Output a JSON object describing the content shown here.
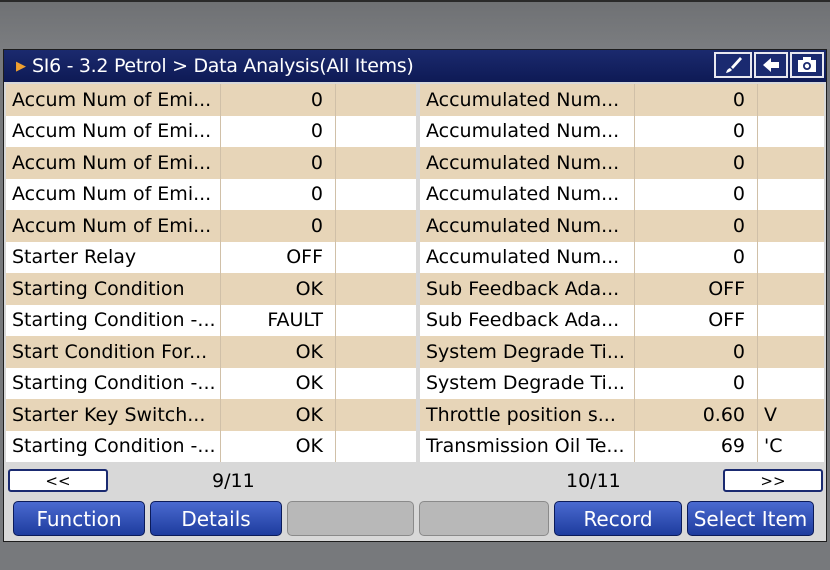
{
  "header": {
    "title": "SI6 - 3.2 Petrol > Data Analysis(All Items)"
  },
  "left_rows": [
    {
      "name": "Accum Num of Emi...",
      "value": "0",
      "unit": ""
    },
    {
      "name": "Accum Num of Emi...",
      "value": "0",
      "unit": ""
    },
    {
      "name": "Accum Num of Emi...",
      "value": "0",
      "unit": ""
    },
    {
      "name": "Accum Num of Emi...",
      "value": "0",
      "unit": ""
    },
    {
      "name": "Accum Num of Emi...",
      "value": "0",
      "unit": ""
    },
    {
      "name": "Starter Relay",
      "value": "OFF",
      "unit": ""
    },
    {
      "name": "Starting Condition",
      "value": "OK",
      "unit": ""
    },
    {
      "name": "Starting Condition -...",
      "value": "FAULT",
      "unit": ""
    },
    {
      "name": "Start Condition For...",
      "value": "OK",
      "unit": ""
    },
    {
      "name": "Starting Condition -...",
      "value": "OK",
      "unit": ""
    },
    {
      "name": "Starter Key Switch...",
      "value": "OK",
      "unit": ""
    },
    {
      "name": "Starting Condition -...",
      "value": "OK",
      "unit": ""
    }
  ],
  "right_rows": [
    {
      "name": "Accumulated Num...",
      "value": "0",
      "unit": ""
    },
    {
      "name": "Accumulated Num...",
      "value": "0",
      "unit": ""
    },
    {
      "name": "Accumulated Num...",
      "value": "0",
      "unit": ""
    },
    {
      "name": "Accumulated Num...",
      "value": "0",
      "unit": ""
    },
    {
      "name": "Accumulated Num...",
      "value": "0",
      "unit": ""
    },
    {
      "name": "Accumulated Num...",
      "value": "0",
      "unit": ""
    },
    {
      "name": "Sub Feedback Ada...",
      "value": "OFF",
      "unit": ""
    },
    {
      "name": "Sub Feedback Ada...",
      "value": "OFF",
      "unit": ""
    },
    {
      "name": "System Degrade Ti...",
      "value": "0",
      "unit": ""
    },
    {
      "name": "System Degrade Ti...",
      "value": "0",
      "unit": ""
    },
    {
      "name": "Throttle position s...",
      "value": "0.60",
      "unit": "V"
    },
    {
      "name": "Transmission Oil Te...",
      "value": "69",
      "unit": "'C"
    }
  ],
  "pager": {
    "prev_label": "<<",
    "next_label": ">>",
    "left_page": "9/11",
    "right_page": "10/11"
  },
  "functions": {
    "function": "Function",
    "details": "Details",
    "record": "Record",
    "select_item": "Select Item"
  },
  "icons": {
    "brush": "brush-icon",
    "back": "back-arrow-icon",
    "camera": "camera-icon"
  },
  "colors": {
    "title_bg": "#0e1a55",
    "row_tan": "#e7d5b8",
    "button_blue": "#1e3c9e"
  }
}
